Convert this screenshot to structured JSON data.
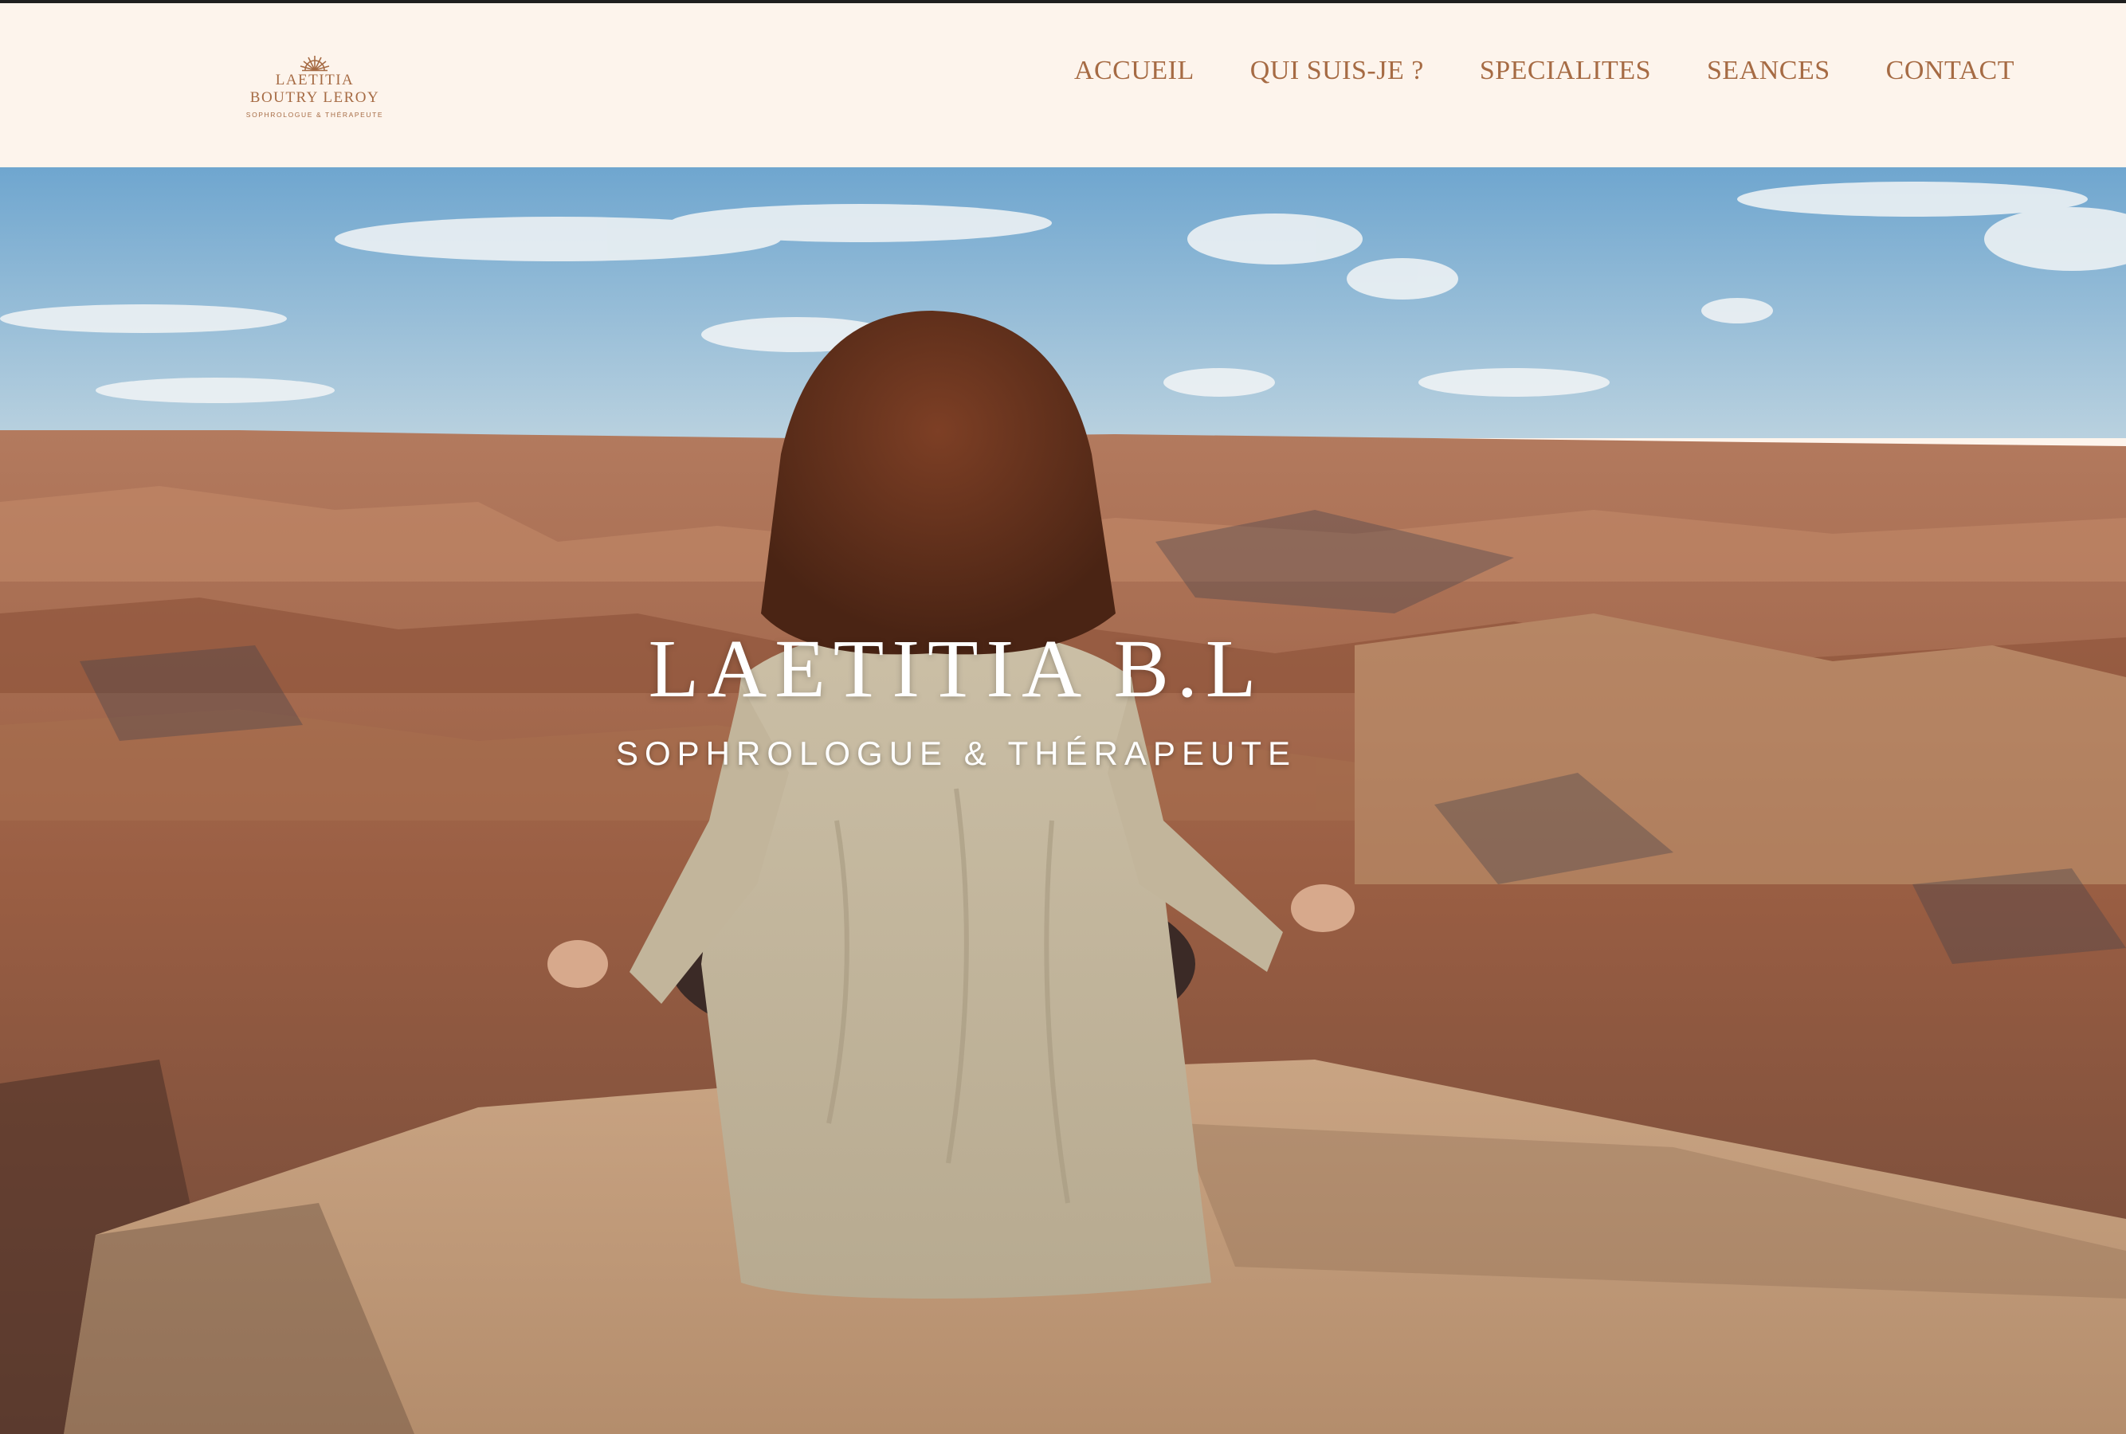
{
  "brand": {
    "logo_line1": "LAETITIA",
    "logo_line2": "BOUTRY LEROY",
    "logo_tagline": "SOPHROLOGUE & THÉRAPEUTE",
    "icon": "sun-rays-icon",
    "color": "#a66b44"
  },
  "nav": {
    "items": [
      {
        "label": "ACCUEIL"
      },
      {
        "label": "QUI SUIS-JE ?"
      },
      {
        "label": "SPECIALITES"
      },
      {
        "label": "SEANCES"
      },
      {
        "label": "CONTACT"
      }
    ]
  },
  "hero": {
    "title": "LAETITIA B.L",
    "subtitle": "SOPHROLOGUE & THÉRAPEUTE",
    "image": "woman meditating at canyon edge"
  },
  "colors": {
    "header_bg": "#fdf4ec",
    "accent": "#a66b44",
    "hero_text": "#ffffff"
  }
}
